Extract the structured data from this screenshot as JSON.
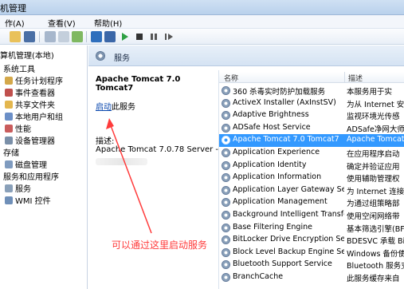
{
  "window": {
    "title": "机管理"
  },
  "menu": {
    "items": [
      "作(A)",
      "查看(V)",
      "帮助(H)"
    ]
  },
  "tree": {
    "items": [
      {
        "label": "算机管理(本地)",
        "indent": 0
      },
      {
        "label": "系统工具",
        "indent": 1
      },
      {
        "label": "任务计划程序",
        "indent": 2
      },
      {
        "label": "事件查看器",
        "indent": 2
      },
      {
        "label": "共享文件夹",
        "indent": 2
      },
      {
        "label": "本地用户和组",
        "indent": 2
      },
      {
        "label": "性能",
        "indent": 2
      },
      {
        "label": "设备管理器",
        "indent": 2
      },
      {
        "label": "存储",
        "indent": 1
      },
      {
        "label": "磁盘管理",
        "indent": 2
      },
      {
        "label": "服务和应用程序",
        "indent": 1
      },
      {
        "label": "服务",
        "indent": 2
      },
      {
        "label": "WMI 控件",
        "indent": 2
      }
    ]
  },
  "pane": {
    "title": "服务",
    "service_name": "Apache Tomcat 7.0 Tomcat7",
    "start_link": "启动",
    "start_suffix": "此服务",
    "desc_label": "描述:",
    "desc_value": "Apache Tomcat 7.0.78 Server -"
  },
  "list": {
    "col_name": "名称",
    "col_desc": "描述",
    "rows": [
      {
        "name": "360 杀毒实时防护加载服务",
        "desc": "本服务用于实",
        "selected": false
      },
      {
        "name": "ActiveX Installer (AxInstSV)",
        "desc": "为从 Internet 安",
        "selected": false
      },
      {
        "name": "Adaptive Brightness",
        "desc": "监视环境光传感",
        "selected": false
      },
      {
        "name": "ADSafe Host Service",
        "desc": "ADSafe净网大师",
        "selected": false
      },
      {
        "name": "Apache Tomcat 7.0 Tomcat7",
        "desc": "Apache Tomcat",
        "selected": true
      },
      {
        "name": "Application Experience",
        "desc": "在应用程序启动",
        "selected": false
      },
      {
        "name": "Application Identity",
        "desc": "确定并验证应用",
        "selected": false
      },
      {
        "name": "Application Information",
        "desc": "使用辅助管理权",
        "selected": false
      },
      {
        "name": "Application Layer Gateway Serv...",
        "desc": "为 Internet 连接",
        "selected": false
      },
      {
        "name": "Application Management",
        "desc": "为通过组策略部",
        "selected": false
      },
      {
        "name": "Background Intelligent Transfe...",
        "desc": "使用空闲网络带",
        "selected": false
      },
      {
        "name": "Base Filtering Engine",
        "desc": "基本筛选引擎(BF",
        "selected": false
      },
      {
        "name": "BitLocker Drive Encryption Serv...",
        "desc": "BDESVC 承载 Bi",
        "selected": false
      },
      {
        "name": "Block Level Backup Engine Serv...",
        "desc": "Windows 备份使",
        "selected": false
      },
      {
        "name": "Bluetooth Support Service",
        "desc": "Bluetooth 服务支",
        "selected": false
      },
      {
        "name": "BranchCache",
        "desc": "此服务缓存来自",
        "selected": false
      }
    ]
  },
  "annotation": {
    "text": "可以通过这里启动服务",
    "color": "#ff3b3b"
  }
}
